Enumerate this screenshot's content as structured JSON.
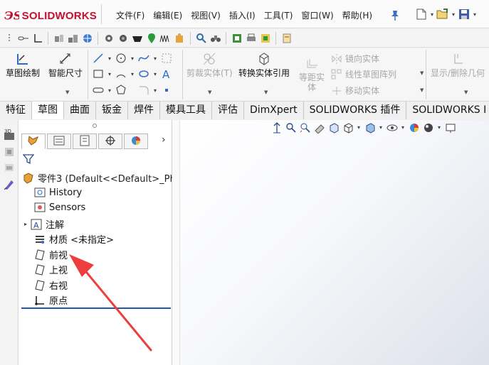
{
  "app": {
    "logo_ds": "ЭS",
    "logo_word": "SOLIDWORKS"
  },
  "menu": [
    "文件(F)",
    "编辑(E)",
    "视图(V)",
    "插入(I)",
    "工具(T)",
    "窗口(W)",
    "帮助(H)"
  ],
  "ribbon": {
    "sketch_label": "草图绘制",
    "smart_dim_label": "智能尺寸",
    "trim_label": "剪裁实体(T)",
    "convert_label": "转换实体引用",
    "offset_label_1": "等距实",
    "offset_label_2": "体",
    "mirror_label": "镜向实体",
    "linear_pattern_label": "线性草图阵列",
    "move_label": "移动实体",
    "show_hide_label": "显示/删除几何"
  },
  "tabs": [
    "特征",
    "草图",
    "曲面",
    "钣金",
    "焊件",
    "模具工具",
    "评估",
    "DimXpert",
    "SOLIDWORKS 插件",
    "SOLIDWORKS I"
  ],
  "active_tab": "草图",
  "tree": {
    "root": "零件3  (Default<<Default>_Ph",
    "items": [
      {
        "label": "History",
        "icon": "history-folder-icon"
      },
      {
        "label": "Sensors",
        "icon": "sensors-folder-icon"
      },
      {
        "label": "注解",
        "icon": "annotations-icon"
      },
      {
        "label": "材质 <未指定>",
        "icon": "material-icon"
      },
      {
        "label": "前视",
        "icon": "plane-icon"
      },
      {
        "label": "上视",
        "icon": "plane-icon"
      },
      {
        "label": "右视",
        "icon": "plane-icon"
      },
      {
        "label": "原点",
        "icon": "origin-icon"
      }
    ]
  },
  "colors": {
    "logo_red": "#c8102e",
    "rollback_blue": "#2157a8",
    "arrow_red": "#ee3d3d",
    "tab_active_bg": "#ffffff"
  }
}
